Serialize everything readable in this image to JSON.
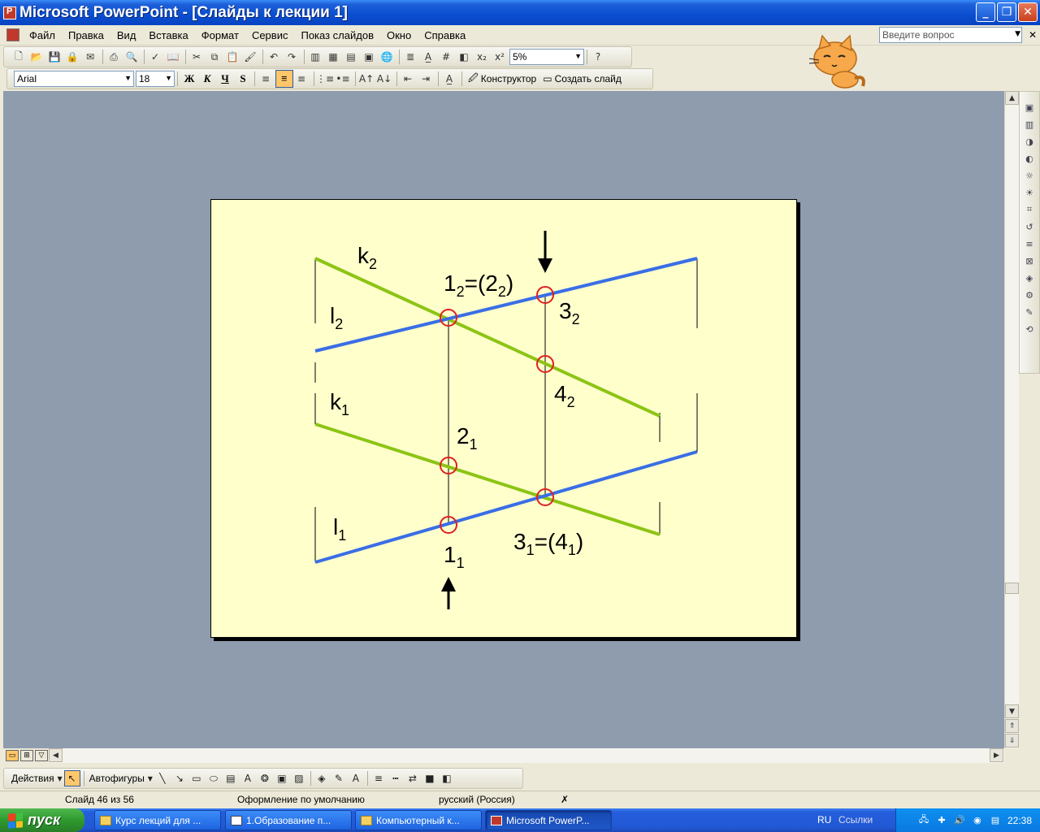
{
  "window": {
    "title": "Microsoft PowerPoint - [Слайды к лекции 1]",
    "minimize": "_",
    "restore": "❐",
    "close": "✕"
  },
  "menu": {
    "items": [
      "Файл",
      "Правка",
      "Вид",
      "Вставка",
      "Формат",
      "Сервис",
      "Показ слайдов",
      "Окно",
      "Справка"
    ],
    "help_placeholder": "Введите вопрос"
  },
  "toolbar": {
    "zoom": "5%",
    "font_name": "Arial",
    "font_size": "18",
    "bold": "Ж",
    "italic": "К",
    "underline": "Ч",
    "shadow": "S",
    "designer": "Конструктор",
    "new_slide": "Создать слайд"
  },
  "slide": {
    "labels": {
      "k2": "k",
      "k2_sub": "2",
      "l2": "l",
      "l2_sub": "2",
      "k1": "k",
      "k1_sub": "1",
      "l1": "l",
      "l1_sub": "1",
      "p12": "1",
      "p12_sub": "2",
      "p12_eq": "=(2",
      "p12_eq_sub": "2",
      "p12_close": ")",
      "p32": "3",
      "p32_sub": "2",
      "p42": "4",
      "p42_sub": "2",
      "p21": "2",
      "p21_sub": "1",
      "p11": "1",
      "p11_sub": "1",
      "p31": "3",
      "p31_sub": "1",
      "p31_eq": "=(4",
      "p31_eq_sub": "1",
      "p31_close": ")"
    },
    "colors": {
      "blue": "#3a6ee6",
      "green": "#8cc414",
      "red": "#e02020",
      "background": "#ffffcc"
    }
  },
  "drawing": {
    "actions": "Действия",
    "autoshapes": "Автофигуры"
  },
  "status": {
    "slide": "Слайд 46 из 56",
    "design": "Оформление по умолчанию",
    "language": "русский (Россия)"
  },
  "taskbar": {
    "start": "пуск",
    "tasks": [
      "Курс лекций для ...",
      "1.Образование п...",
      "Компьютерный к...",
      "Microsoft PowerP..."
    ],
    "lang": "RU",
    "links": "Ссылки",
    "time": "22:38"
  }
}
